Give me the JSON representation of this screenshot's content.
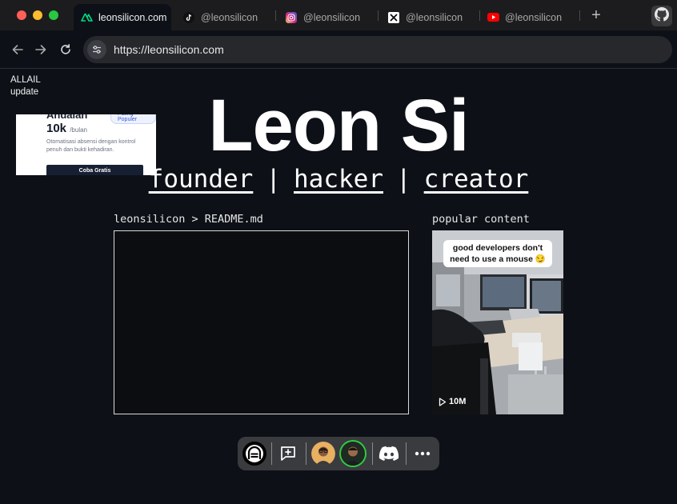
{
  "browser": {
    "tabs": [
      {
        "title": "leonsilicon.com",
        "icon": "nuxt-icon",
        "active": true
      },
      {
        "title": "@leonsilicon",
        "icon": "tiktok-icon",
        "active": false
      },
      {
        "title": "@leonsilicon",
        "icon": "instagram-icon",
        "active": false
      },
      {
        "title": "@leonsilicon",
        "icon": "x-icon",
        "active": false
      },
      {
        "title": "@leonsilicon",
        "icon": "youtube-icon",
        "active": false
      }
    ],
    "new_tab_label": "+",
    "url": "https://leonsilicon.com"
  },
  "ad": {
    "label_line1": "ALLAIL",
    "label_line2": "update",
    "plan_name": "Andalan",
    "badge": "Paling Populer",
    "price": "10k",
    "price_unit": "/bulan",
    "description": "Otomatisasi absensi dengan kontrol penuh dan bukti kehadiran.",
    "cta": "Coba Gratis"
  },
  "hero": {
    "name": "Leon Si",
    "roles": [
      "founder",
      "hacker",
      "creator"
    ],
    "separator": "|"
  },
  "readme": {
    "label": "leonsilicon > README.md"
  },
  "popular": {
    "label": "popular content",
    "caption": "good developers don't need to use a mouse 😏",
    "views": "10M"
  },
  "colors": {
    "page_bg": "#0d1117",
    "tab_bar": "#1c1c1e",
    "dock_bg": "#3a3b3f",
    "discord": "#ffffff"
  }
}
